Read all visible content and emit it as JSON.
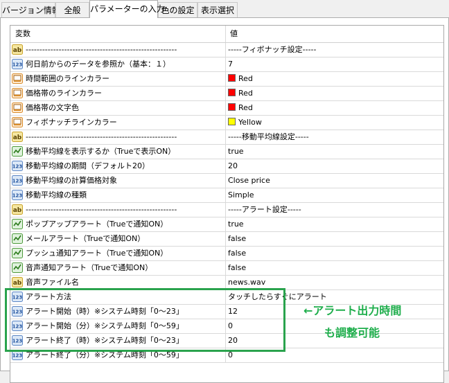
{
  "tabs": [
    {
      "label": "バージョン情報"
    },
    {
      "label": "全般"
    },
    {
      "label": "パラメーターの入力"
    },
    {
      "label": "色の設定"
    },
    {
      "label": "表示選択"
    }
  ],
  "table": {
    "headers": {
      "variable": "変数",
      "value": "値"
    },
    "rows": [
      {
        "icon": "ab",
        "name": "-------------------------------------------------------",
        "value": "-----フィボナッチ設定-----"
      },
      {
        "icon": "123",
        "name": "何日前からのデータを参照か（基本：１）",
        "value": "7"
      },
      {
        "icon": "color",
        "name": "時間範囲のラインカラー",
        "value": "Red",
        "color": "#ff0000"
      },
      {
        "icon": "color",
        "name": "価格帯のラインカラー",
        "value": "Red",
        "color": "#ff0000"
      },
      {
        "icon": "color",
        "name": "価格帯の文字色",
        "value": "Red",
        "color": "#ff0000"
      },
      {
        "icon": "color",
        "name": "フィボナッチラインカラー",
        "value": "Yellow",
        "color": "#ffff00"
      },
      {
        "icon": "ab",
        "name": "-------------------------------------------------------",
        "value": "-----移動平均線設定-----"
      },
      {
        "icon": "bool",
        "name": "移動平均線を表示するか（Trueで表示ON）",
        "value": "true"
      },
      {
        "icon": "123",
        "name": "移動平均線の期間（デフォルト20）",
        "value": "20"
      },
      {
        "icon": "123",
        "name": "移動平均線の計算価格対象",
        "value": "Close price"
      },
      {
        "icon": "123",
        "name": "移動平均線の種類",
        "value": "Simple"
      },
      {
        "icon": "ab",
        "name": "-------------------------------------------------------",
        "value": "-----アラート設定-----"
      },
      {
        "icon": "bool",
        "name": "ポップアップアラート（Trueで通知ON）",
        "value": "true"
      },
      {
        "icon": "bool",
        "name": "メールアラート（Trueで通知ON）",
        "value": "false"
      },
      {
        "icon": "bool",
        "name": "プッシュ通知アラート（Trueで通知ON）",
        "value": "false"
      },
      {
        "icon": "bool",
        "name": "音声通知アラート（Trueで通知ON）",
        "value": "false"
      },
      {
        "icon": "ab",
        "name": "音声ファイル名",
        "value": "news.wav"
      },
      {
        "icon": "123",
        "name": "アラート方法",
        "value": "タッチしたらすぐにアラート"
      },
      {
        "icon": "123",
        "name": "アラート開始（時）※システム時刻「0～23」",
        "value": "12"
      },
      {
        "icon": "123",
        "name": "アラート開始（分）※システム時刻「0～59」",
        "value": "0"
      },
      {
        "icon": "123",
        "name": "アラート終了（時）※システム時刻「0～23」",
        "value": "20"
      },
      {
        "icon": "123",
        "name": "アラート終了（分）※システム時刻「0～59」",
        "value": "0"
      }
    ]
  },
  "annotation": {
    "line1": "←アラート出力時間",
    "line2": "も調整可能",
    "color": "#1fae4c"
  },
  "icon_types": {
    "ab": "string-type-icon",
    "123": "integer-type-icon",
    "color": "color-type-icon",
    "bool": "boolean-type-icon"
  }
}
